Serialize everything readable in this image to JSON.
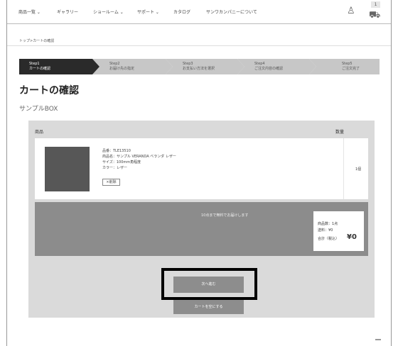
{
  "nav": {
    "items": [
      "商品一覧 ⌄",
      "ギャラリー",
      "ショールーム ⌄",
      "サポート ⌄",
      "カタログ",
      "サンワカンパニーについて"
    ],
    "user_icon": "user-icon",
    "cart_icon": "cart-icon",
    "cart_count": "1"
  },
  "breadcrumb": "トップ>カートの確認",
  "steps": [
    {
      "num": "Step1",
      "label": "カートの確認",
      "active": true
    },
    {
      "num": "Step2",
      "label": "お届け先の指定",
      "active": false
    },
    {
      "num": "Step3",
      "label": "お支払い方法を選択",
      "active": false
    },
    {
      "num": "Step4",
      "label": "ご注文内容の確認",
      "active": false
    },
    {
      "num": "Step5",
      "label": "ご注文完了",
      "active": false
    }
  ],
  "page_title": "カートの確認",
  "subtitle": "サンプルBOX",
  "cart": {
    "header_product": "商品",
    "header_qty": "数量",
    "item": {
      "code": "品番：TLE13510",
      "name": "商品名：サンプル VERANDA ベランダ レザー",
      "size": "サイズ：100mm角程度",
      "color": "カラー：レザー",
      "delete_label": "×削除",
      "qty": "1個"
    },
    "summary_note": "10点まで無料でお届けします",
    "totals": {
      "count_label": "商品数：1点",
      "price_label": "送料：¥0",
      "total_label": "合計（税込）",
      "total_value": "¥0"
    }
  },
  "buttons": {
    "confirm": "次へ進む",
    "empty": "カートを空にする"
  }
}
